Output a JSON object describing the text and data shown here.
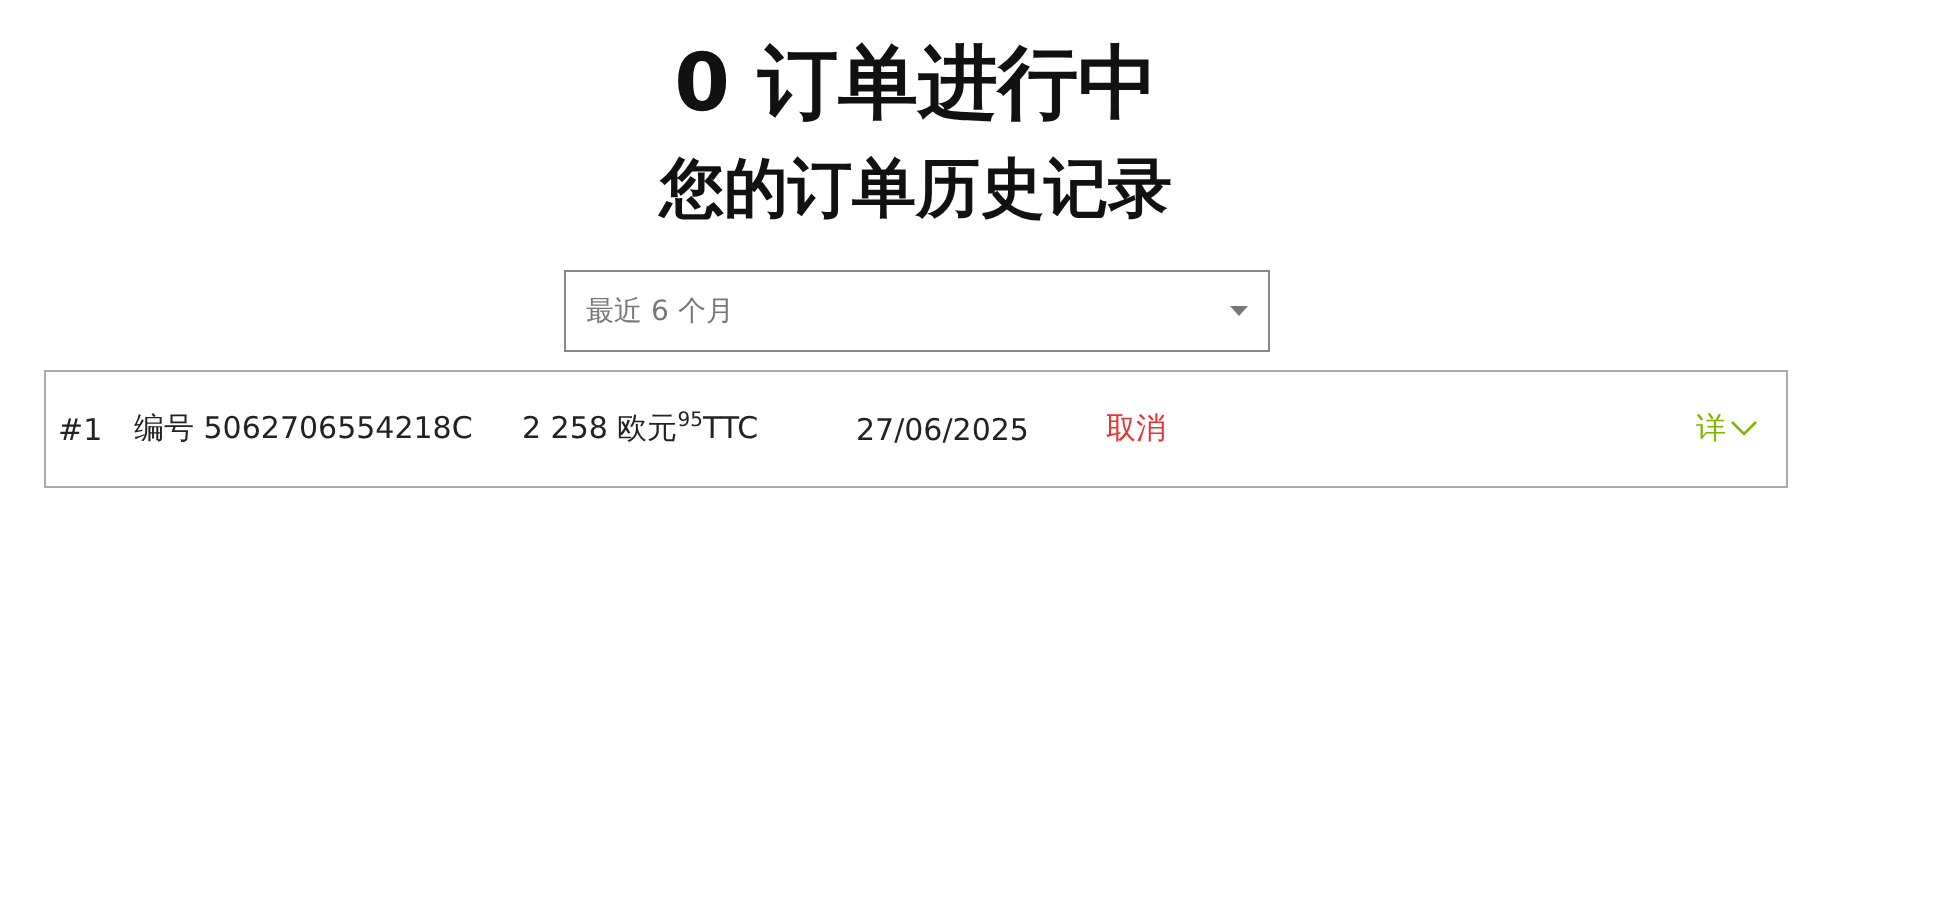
{
  "title": "0 订单进行中",
  "subtitle": "您的订单历史记录",
  "period_select": {
    "value": "最近 6 个月"
  },
  "orders": [
    {
      "index": "#1",
      "number": "编号 5062706554218C",
      "total": "2 258 欧元$^{95}$TTC",
      "date": "27/06/2025",
      "status": "取消",
      "details": "详",
      "expanded": false
    }
  ]
}
